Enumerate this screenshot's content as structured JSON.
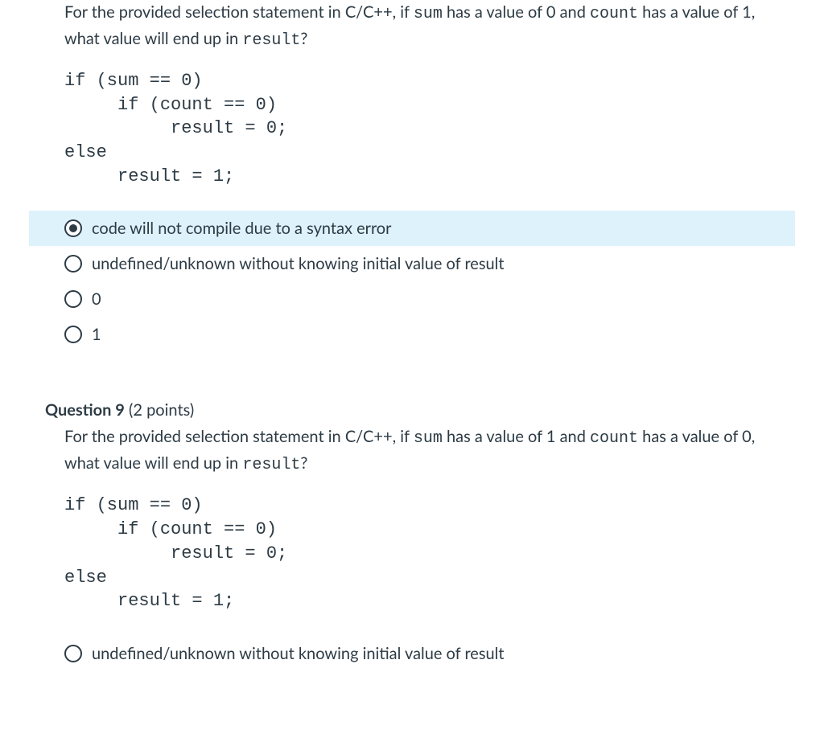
{
  "q8": {
    "prompt_pre": "For the provided selection statement in C/C++, if ",
    "var1": "sum",
    "mid1": " has a value of 0 and ",
    "var2": "count",
    "mid2": " has a value of 1, what value will end up in  ",
    "var3": "result",
    "suffix": "?",
    "code": "if (sum == 0)\n     if (count == 0)\n          result = 0;\nelse\n     result = 1;",
    "options": [
      {
        "label": "code will not compile due to a syntax error",
        "selected": true
      },
      {
        "label": "undefined/unknown without knowing initial value of result",
        "selected": false
      },
      {
        "label": "0",
        "selected": false
      },
      {
        "label": "1",
        "selected": false
      }
    ]
  },
  "q9": {
    "header_bold": "Question 9",
    "header_rest": " (2 points)",
    "prompt_pre": "For the provided selection statement in C/C++, if ",
    "var1": "sum",
    "mid1": " has a value of 1 and ",
    "var2": "count",
    "mid2": " has a value of 0, what value will end up in  ",
    "var3": "result",
    "suffix": "?",
    "code": "if (sum == 0)\n     if (count == 0)\n          result = 0;\nelse\n     result = 1;",
    "options": [
      {
        "label": "undefined/unknown without knowing initial value of result",
        "selected": false
      }
    ]
  }
}
